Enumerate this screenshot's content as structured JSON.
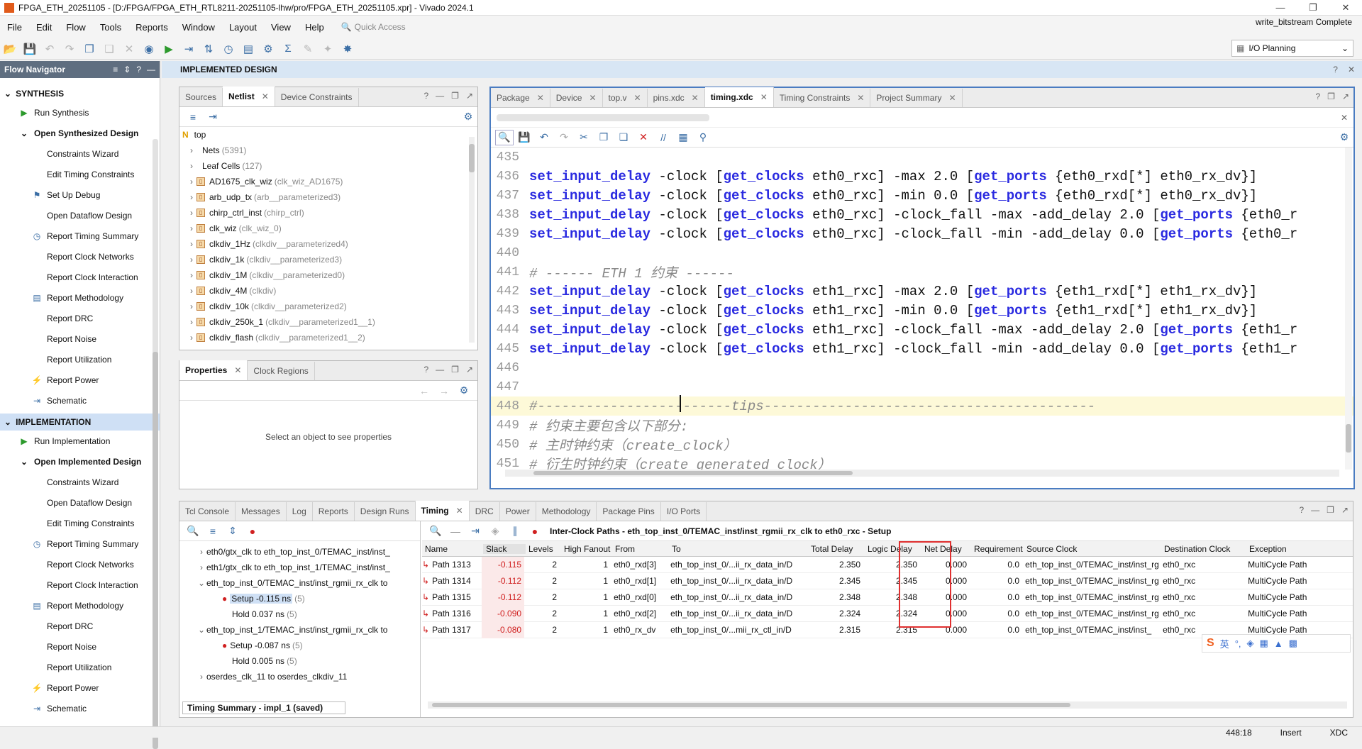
{
  "window": {
    "title": "FPGA_ETH_20251105 - [D:/FPGA/FPGA_ETH_RTL8211-20251105-lhw/pro/FPGA_ETH_20251105.xpr] - Vivado 2024.1",
    "status": "write_bitstream Complete"
  },
  "menu": [
    "File",
    "Edit",
    "Flow",
    "Tools",
    "Reports",
    "Window",
    "Layout",
    "View",
    "Help"
  ],
  "quick_access": "Quick Access",
  "layout_select": "I/O Planning",
  "flow_nav": {
    "title": "Flow Navigator",
    "synthesis": {
      "label": "SYNTHESIS",
      "run": "Run Synthesis",
      "open": "Open Synthesized Design",
      "items": [
        "Constraints Wizard",
        "Edit Timing Constraints",
        "Set Up Debug",
        "Open Dataflow Design",
        "Report Timing Summary",
        "Report Clock Networks",
        "Report Clock Interaction",
        "Report Methodology",
        "Report DRC",
        "Report Noise",
        "Report Utilization",
        "Report Power",
        "Schematic"
      ]
    },
    "implementation": {
      "label": "IMPLEMENTATION",
      "run": "Run Implementation",
      "open": "Open Implemented Design",
      "items": [
        "Constraints Wizard",
        "Open Dataflow Design",
        "Edit Timing Constraints",
        "Report Timing Summary",
        "Report Clock Networks",
        "Report Clock Interaction",
        "Report Methodology",
        "Report DRC",
        "Report Noise",
        "Report Utilization",
        "Report Power",
        "Schematic"
      ]
    }
  },
  "impl_header": "IMPLEMENTED DESIGN",
  "netlist": {
    "tabs": [
      "Sources",
      "Netlist",
      "Device Constraints"
    ],
    "root": "top",
    "rows": [
      {
        "name": "Nets",
        "sub": "(5391)",
        "cell": false
      },
      {
        "name": "Leaf Cells",
        "sub": "(127)",
        "cell": false
      },
      {
        "name": "AD1675_clk_wiz",
        "sub": "(clk_wiz_AD1675)",
        "cell": true
      },
      {
        "name": "arb_udp_tx",
        "sub": "(arb__parameterized3)",
        "cell": true
      },
      {
        "name": "chirp_ctrl_inst",
        "sub": "(chirp_ctrl)",
        "cell": true
      },
      {
        "name": "clk_wiz",
        "sub": "(clk_wiz_0)",
        "cell": true
      },
      {
        "name": "clkdiv_1Hz",
        "sub": "(clkdiv__parameterized4)",
        "cell": true
      },
      {
        "name": "clkdiv_1k",
        "sub": "(clkdiv__parameterized3)",
        "cell": true
      },
      {
        "name": "clkdiv_1M",
        "sub": "(clkdiv__parameterized0)",
        "cell": true
      },
      {
        "name": "clkdiv_4M",
        "sub": "(clkdiv)",
        "cell": true
      },
      {
        "name": "clkdiv_10k",
        "sub": "(clkdiv__parameterized2)",
        "cell": true
      },
      {
        "name": "clkdiv_250k_1",
        "sub": "(clkdiv__parameterized1__1)",
        "cell": true
      },
      {
        "name": "clkdiv_flash",
        "sub": "(clkdiv__parameterized1__2)",
        "cell": true
      }
    ]
  },
  "properties": {
    "tabs": [
      "Properties",
      "Clock Regions"
    ],
    "empty": "Select an object to see properties"
  },
  "editor": {
    "tabs": [
      "Package",
      "Device",
      "top.v",
      "pins.xdc",
      "timing.xdc",
      "Timing Constraints",
      "Project Summary"
    ],
    "active_tab": "timing.xdc",
    "lines": [
      {
        "n": "435",
        "t": ""
      },
      {
        "n": "436",
        "t": "set_input_delay -clock [get_clocks eth0_rxc] -max 2.0 [get_ports {eth0_rxd[*] eth0_rx_dv}]"
      },
      {
        "n": "437",
        "t": "set_input_delay -clock [get_clocks eth0_rxc] -min 0.0 [get_ports {eth0_rxd[*] eth0_rx_dv}]"
      },
      {
        "n": "438",
        "t": "set_input_delay -clock [get_clocks eth0_rxc] -clock_fall -max -add_delay 2.0 [get_ports {eth0_r"
      },
      {
        "n": "439",
        "t": "set_input_delay -clock [get_clocks eth0_rxc] -clock_fall -min -add_delay 0.0 [get_ports {eth0_r"
      },
      {
        "n": "440",
        "t": ""
      },
      {
        "n": "441",
        "t": "# ------ ETH 1 约束 ------"
      },
      {
        "n": "442",
        "t": "set_input_delay -clock [get_clocks eth1_rxc] -max 2.0 [get_ports {eth1_rxd[*] eth1_rx_dv}]"
      },
      {
        "n": "443",
        "t": "set_input_delay -clock [get_clocks eth1_rxc] -min 0.0 [get_ports {eth1_rxd[*] eth1_rx_dv}]"
      },
      {
        "n": "444",
        "t": "set_input_delay -clock [get_clocks eth1_rxc] -clock_fall -max -add_delay 2.0 [get_ports {eth1_r"
      },
      {
        "n": "445",
        "t": "set_input_delay -clock [get_clocks eth1_rxc] -clock_fall -min -add_delay 0.0 [get_ports {eth1_r"
      },
      {
        "n": "446",
        "t": ""
      },
      {
        "n": "447",
        "t": ""
      },
      {
        "n": "448",
        "t": "#------------------------tips-----------------------------------------"
      },
      {
        "n": "449",
        "t": "# 约束主要包含以下部分:"
      },
      {
        "n": "450",
        "t": "# 主时钟约束（create_clock）"
      },
      {
        "n": "451",
        "t": "# 衍生时钟约束（create_generated_clock）"
      }
    ]
  },
  "bottom": {
    "tabs": [
      "Tcl Console",
      "Messages",
      "Log",
      "Reports",
      "Design Runs",
      "Timing",
      "DRC",
      "Power",
      "Methodology",
      "Package Pins",
      "I/O Ports"
    ],
    "active_tab": "Timing",
    "tree": [
      {
        "t": "eth0/gtx_clk to eth_top_inst_0/TEMAC_inst/inst_",
        "lvl": 0,
        "exp": ">"
      },
      {
        "t": "eth1/gtx_clk to eth_top_inst_1/TEMAC_inst/inst_",
        "lvl": 0,
        "exp": ">"
      },
      {
        "t": "eth_top_inst_0/TEMAC_inst/inst_rgmii_rx_clk to",
        "lvl": 0,
        "exp": "v"
      },
      {
        "t": "Setup -0.115 ns",
        "sub": "(5)",
        "lvl": 1,
        "err": true,
        "sel": true
      },
      {
        "t": "Hold 0.037 ns",
        "sub": "(5)",
        "lvl": 1
      },
      {
        "t": "eth_top_inst_1/TEMAC_inst/inst_rgmii_rx_clk to",
        "lvl": 0,
        "exp": "v"
      },
      {
        "t": "Setup -0.087 ns",
        "sub": "(5)",
        "lvl": 1,
        "err": true
      },
      {
        "t": "Hold 0.005 ns",
        "sub": "(5)",
        "lvl": 1
      },
      {
        "t": "oserdes_clk_11 to oserdes_clkdiv_11",
        "lvl": 0,
        "exp": ">"
      }
    ],
    "summary_tab": "Timing Summary - impl_1 (saved)",
    "paths_title": "Inter-Clock Paths - eth_top_inst_0/TEMAC_inst/inst_rgmii_rx_clk to eth0_rxc - Setup",
    "columns": [
      "Name",
      "Slack",
      "Levels",
      "High Fanout",
      "From",
      "To",
      "Total Delay",
      "Logic Delay",
      "Net Delay",
      "Requirement",
      "Source Clock",
      "Destination Clock",
      "Exception"
    ],
    "rows": [
      [
        "Path 1313",
        "-0.115",
        "2",
        "1",
        "eth0_rxd[3]",
        "eth_top_inst_0/...ii_rx_data_in/D",
        "2.350",
        "2.350",
        "0.000",
        "0.0",
        "eth_top_inst_0/TEMAC_inst/inst_rg",
        "eth0_rxc",
        "MultiCycle Path"
      ],
      [
        "Path 1314",
        "-0.112",
        "2",
        "1",
        "eth0_rxd[1]",
        "eth_top_inst_0/...ii_rx_data_in/D",
        "2.345",
        "2.345",
        "0.000",
        "0.0",
        "eth_top_inst_0/TEMAC_inst/inst_rg",
        "eth0_rxc",
        "MultiCycle Path"
      ],
      [
        "Path 1315",
        "-0.112",
        "2",
        "1",
        "eth0_rxd[0]",
        "eth_top_inst_0/...ii_rx_data_in/D",
        "2.348",
        "2.348",
        "0.000",
        "0.0",
        "eth_top_inst_0/TEMAC_inst/inst_rg",
        "eth0_rxc",
        "MultiCycle Path"
      ],
      [
        "Path 1316",
        "-0.090",
        "2",
        "1",
        "eth0_rxd[2]",
        "eth_top_inst_0/...ii_rx_data_in/D",
        "2.324",
        "2.324",
        "0.000",
        "0.0",
        "eth_top_inst_0/TEMAC_inst/inst_rg",
        "eth0_rxc",
        "MultiCycle Path"
      ],
      [
        "Path 1317",
        "-0.080",
        "2",
        "1",
        "eth0_rx_dv",
        "eth_top_inst_0/...mii_rx_ctl_in/D",
        "2.315",
        "2.315",
        "0.000",
        "0.0",
        "eth_top_inst_0/TEMAC_inst/inst_",
        "eth0_rxc",
        "MultiCycle Path"
      ]
    ]
  },
  "statusbar": {
    "pos": "448:18",
    "mode": "Insert",
    "type": "XDC"
  },
  "ime": {
    "lang": "英"
  }
}
